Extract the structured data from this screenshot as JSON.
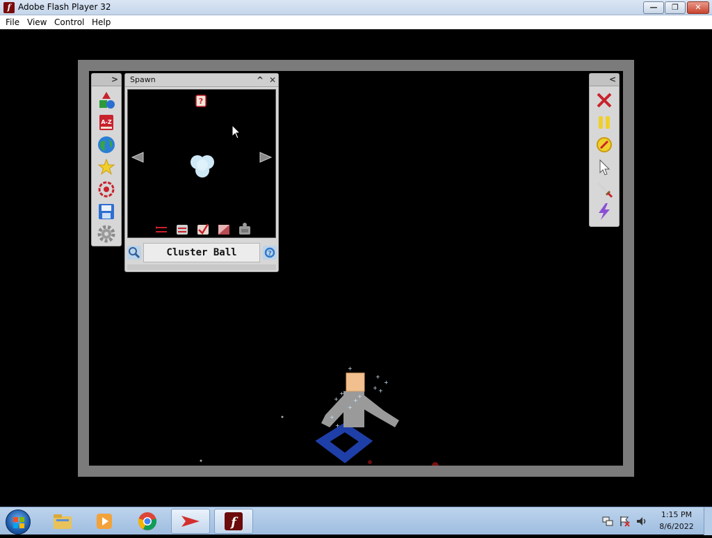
{
  "window": {
    "title": "Adobe Flash Player 32",
    "icon": "flash-icon",
    "controls": {
      "minimize": "—",
      "maximize": "❐",
      "close": "✕"
    }
  },
  "menu": {
    "items": [
      "File",
      "View",
      "Control",
      "Help"
    ]
  },
  "left_toolbar": {
    "collapse_arrow": ">",
    "tools": [
      "shapes-icon",
      "a-z-icon",
      "globe-icon",
      "star-icon",
      "target-icon",
      "save-icon",
      "gear-icon"
    ],
    "az_label": "A-Z"
  },
  "spawn_panel": {
    "title": "Spawn",
    "minimize": "^",
    "close": "✕",
    "selected_item_name": "Cluster Ball",
    "preview_icon": "cluster-ball-icon",
    "help_glyph": "?",
    "bottom_tools": [
      "flip-icon",
      "swap-icon",
      "check-icon",
      "gradient-icon",
      "bot-icon"
    ]
  },
  "right_toolbar": {
    "collapse_arrow": "<",
    "tools": [
      "close-x-icon",
      "pause-icon",
      "compass-icon",
      "pointer-icon",
      "sword-icon",
      "lightning-icon"
    ]
  },
  "taskbar": {
    "apps": [
      "explorer-icon",
      "media-player-icon",
      "chrome-icon",
      "reader-icon",
      "flash-icon"
    ],
    "active_app": "flash-icon",
    "flash_glyph": "f",
    "time": "1:15 PM",
    "date": "8/6/2022"
  },
  "colors": {
    "stage_border": "#7b7b7b",
    "panel_bg": "#d7d7d7",
    "ragdoll_body": "#9a9a9a",
    "ragdoll_head": "#f2c08f",
    "ragdoll_legs": "#1f3fa8",
    "cluster_ball": "#cfe8f6"
  }
}
